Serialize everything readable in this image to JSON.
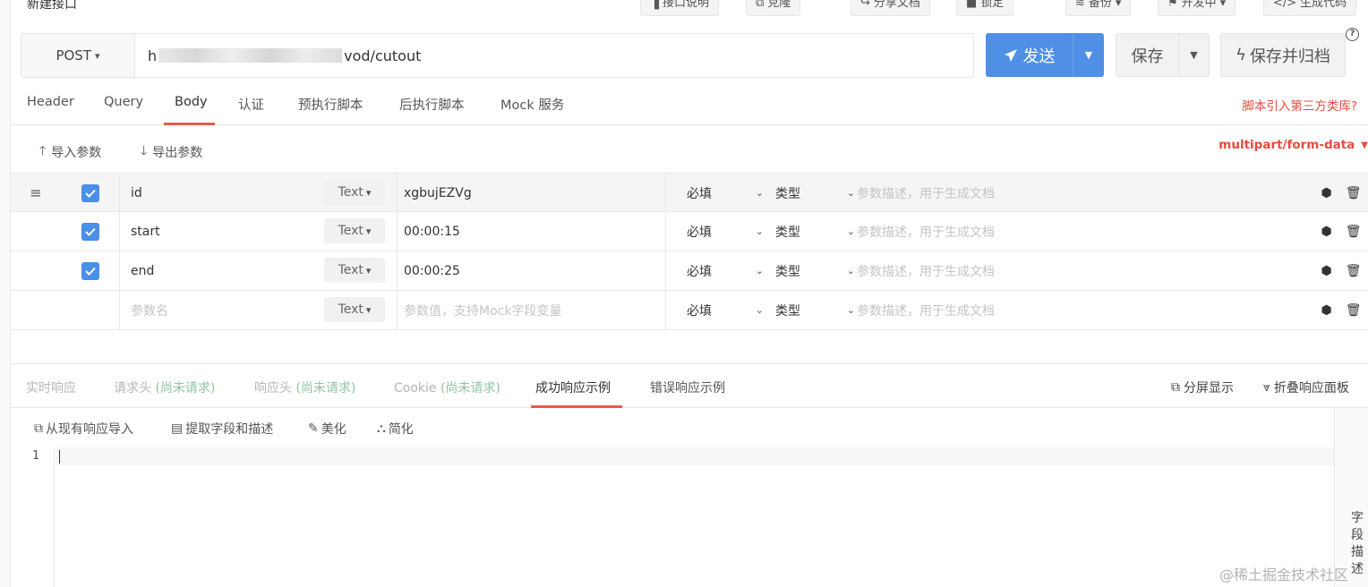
{
  "page": {
    "title": "新建接口"
  },
  "top_actions": [
    {
      "label": "接口说明"
    },
    {
      "label": "克隆"
    },
    {
      "label": "分享文档"
    },
    {
      "label": "锁定"
    },
    {
      "label": "备份"
    },
    {
      "label": "开发中"
    },
    {
      "label": "生成代码"
    }
  ],
  "request": {
    "method": "POST",
    "url_start": "h",
    "url_end": "vod/cutout",
    "send_label": "发送",
    "save_label": "保存",
    "save_return_label": "保存并归档"
  },
  "tabs": [
    "Header",
    "Query",
    "Body",
    "认证",
    "预执行脚本",
    "后执行脚本",
    "Mock 服务"
  ],
  "active_tab": "Body",
  "third_party_link": "脚本引入第三方类库?",
  "body": {
    "import_label": "导入参数",
    "export_label": "导出参数",
    "content_type": "multipart/form-data"
  },
  "params": [
    {
      "name": "id",
      "type": "Text",
      "value": "xgbujEZVg",
      "required": "必填",
      "ptype": "类型",
      "desc_placeholder": "参数描述，用于生成文档"
    },
    {
      "name": "start",
      "type": "Text",
      "value": "00:00:15",
      "required": "必填",
      "ptype": "类型",
      "desc_placeholder": "参数描述，用于生成文档"
    },
    {
      "name": "end",
      "type": "Text",
      "value": "00:00:25",
      "required": "必填",
      "ptype": "类型",
      "desc_placeholder": "参数描述，用于生成文档"
    }
  ],
  "new_param": {
    "name_placeholder": "参数名",
    "type": "Text",
    "value_placeholder": "参数值，支持Mock字段变量",
    "required": "必填",
    "ptype": "类型",
    "desc_placeholder": "参数描述，用于生成文档"
  },
  "response": {
    "tabs": [
      {
        "label": "实时响应",
        "note": ""
      },
      {
        "label": "请求头 ",
        "note": "(尚未请求)"
      },
      {
        "label": "响应头 ",
        "note": "(尚未请求)"
      },
      {
        "label": "Cookie ",
        "note": "(尚未请求)"
      },
      {
        "label": "成功响应示例",
        "note": ""
      },
      {
        "label": "错误响应示例",
        "note": ""
      }
    ],
    "split_label": "分屏显示",
    "collapse_label": "折叠响应面板",
    "tools": [
      "从现有响应导入",
      "提取字段和描述",
      "美化",
      "简化"
    ],
    "line_number": "1",
    "field_panel_label": "字段描述"
  },
  "watermark": "@稀土掘金技术社区"
}
